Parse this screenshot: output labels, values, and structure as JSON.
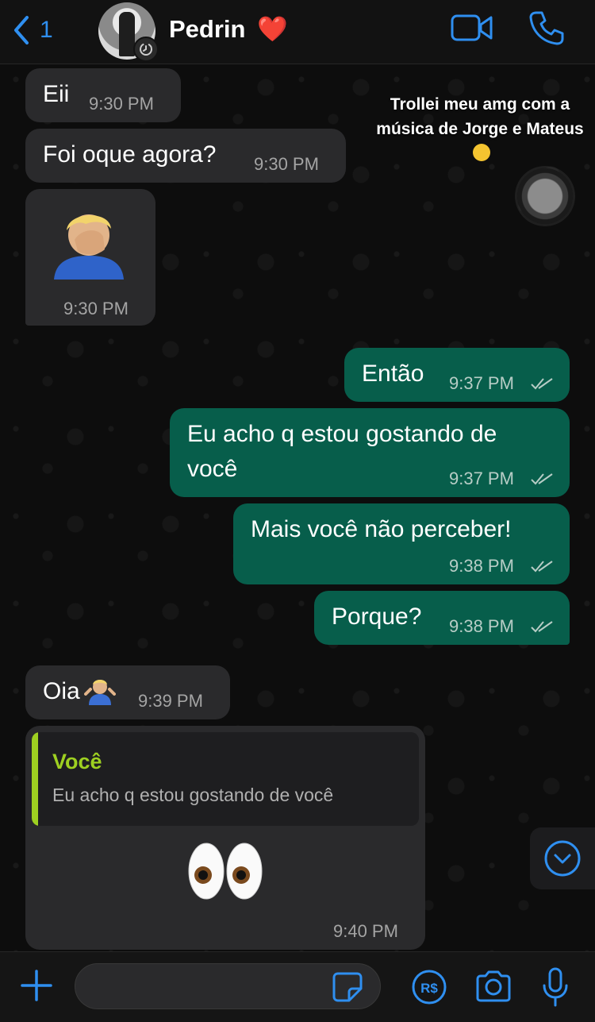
{
  "header": {
    "back_count": "1",
    "contact_name": "Pedrin",
    "contact_emoji": "❤️"
  },
  "overlay": {
    "caption": "Trollei meu amg com a música de Jorge e Mateus",
    "caption_emoji": "🫢"
  },
  "messages": [
    {
      "direction": "in",
      "text": "Eii",
      "time": "9:30 PM"
    },
    {
      "direction": "in",
      "text": "Foi oque agora?",
      "time": "9:30 PM"
    },
    {
      "direction": "in",
      "emoji": "🤦🏼‍♂️",
      "time": "9:30 PM"
    },
    {
      "direction": "out",
      "text": "Então",
      "time": "9:37 PM",
      "status": "read"
    },
    {
      "direction": "out",
      "text_line1": "Eu acho q estou gostando de",
      "text_line2": "você",
      "time": "9:37 PM",
      "status": "read"
    },
    {
      "direction": "out",
      "text": "Mais você não perceber!",
      "time": "9:38 PM",
      "status": "read"
    },
    {
      "direction": "out",
      "text": "Porque?",
      "time": "9:38 PM",
      "status": "read"
    },
    {
      "direction": "in",
      "text": "Oia",
      "emoji": "🤷🏼‍♂️",
      "time": "9:39 PM"
    },
    {
      "direction": "in",
      "quote_author": "Você",
      "quote_text": "Eu acho q estou gostando de você",
      "emoji": "👀",
      "time": "9:40 PM"
    }
  ],
  "composer": {
    "value": "",
    "placeholder": ""
  },
  "colors": {
    "accent": "#2f8ff0",
    "incoming_bubble": "#2a2a2c",
    "outgoing_bubble": "#075e4b",
    "quote_author": "#9ed021"
  }
}
